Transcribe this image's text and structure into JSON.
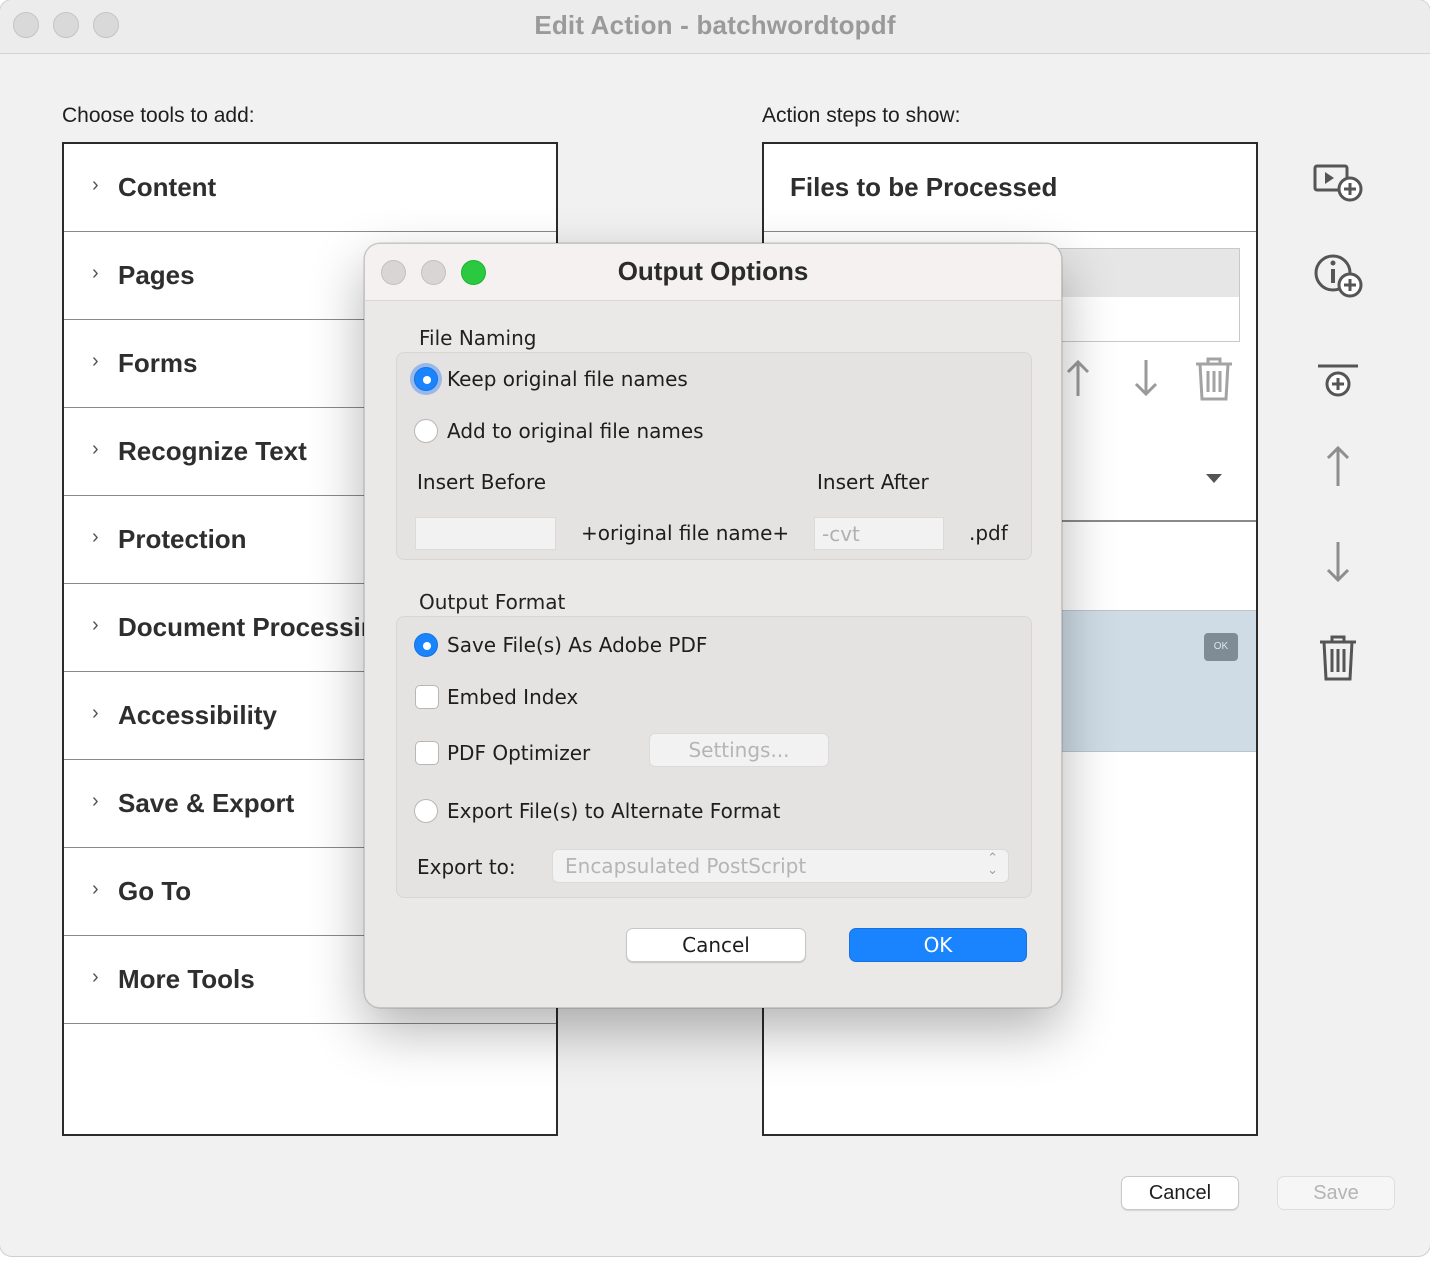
{
  "window": {
    "title": "Edit Action - batchwordtopdf"
  },
  "left_panel": {
    "label": "Choose tools to add:",
    "items": [
      {
        "label": "Content"
      },
      {
        "label": "Pages"
      },
      {
        "label": "Forms"
      },
      {
        "label": "Recognize Text"
      },
      {
        "label": "Protection"
      },
      {
        "label": "Document Processing"
      },
      {
        "label": "Accessibility"
      },
      {
        "label": "Save & Export"
      },
      {
        "label": "Go To"
      },
      {
        "label": "More Tools"
      }
    ]
  },
  "right_panel": {
    "label": "Action steps to show:",
    "header": "Files to be Processed"
  },
  "side_toolbar": {
    "icons": [
      "add-instruction-step-icon",
      "add-info-step-icon",
      "add-panel-separator-icon",
      "move-up-icon",
      "move-down-icon",
      "delete-icon"
    ]
  },
  "footer": {
    "cancel_label": "Cancel",
    "save_label": "Save"
  },
  "dialog": {
    "title": "Output Options",
    "file_naming": {
      "label": "File Naming",
      "keep_label": "Keep original file names",
      "add_label": "Add to original file names",
      "insert_before_label": "Insert Before",
      "insert_after_label": "Insert After",
      "insert_before_value": "",
      "original_name_label": "+original file name+",
      "insert_after_value": "-cvt",
      "extension_label": ".pdf",
      "selected": "keep"
    },
    "output_format": {
      "label": "Output Format",
      "save_pdf_label": "Save File(s) As Adobe PDF",
      "embed_index_label": "Embed Index",
      "pdf_optimizer_label": "PDF Optimizer",
      "settings_label": "Settings...",
      "export_alt_label": "Export File(s) to Alternate Format",
      "export_to_label": "Export to:",
      "export_to_value": "Encapsulated PostScript",
      "selected": "save_pdf",
      "embed_index_checked": false,
      "pdf_optimizer_checked": false
    },
    "cancel_label": "Cancel",
    "ok_label": "OK"
  },
  "colors": {
    "accent": "#1a84ff",
    "selected_step": "#cfdce6",
    "traffic_close": "#d9d9d9",
    "traffic_zoom": "#2ac940"
  }
}
